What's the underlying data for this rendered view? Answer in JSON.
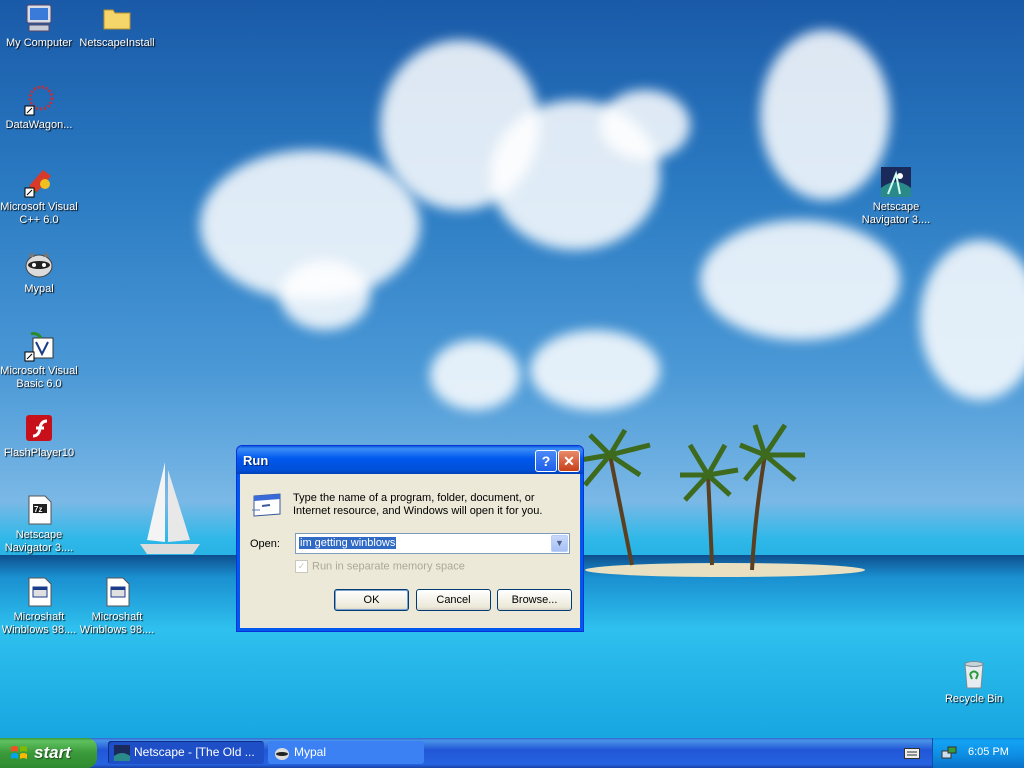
{
  "desktop": {
    "icons": [
      {
        "label": "My Computer",
        "icon": "my-computer-icon"
      },
      {
        "label": "NetscapeInstall",
        "icon": "folder-icon"
      },
      {
        "label": "DataWagon...",
        "icon": "datawagon-icon"
      },
      {
        "label": "Microsoft Visual C++ 6.0",
        "icon": "visual-cpp-icon"
      },
      {
        "label": "Mypal",
        "icon": "mypal-icon"
      },
      {
        "label": "Microsoft Visual Basic 6.0",
        "icon": "visual-basic-icon"
      },
      {
        "label": "FlashPlayer10",
        "icon": "flash-icon"
      },
      {
        "label": "Netscape Navigator 3....",
        "icon": "7z-icon"
      },
      {
        "label": "Microshaft Winblows 98....",
        "icon": "setup-icon"
      },
      {
        "label": "Microshaft Winblows 98....",
        "icon": "setup-icon"
      },
      {
        "label": "Netscape Navigator 3....",
        "icon": "netscape-icon"
      },
      {
        "label": "Recycle Bin",
        "icon": "recycle-bin-icon"
      }
    ]
  },
  "run_dialog": {
    "title": "Run",
    "help_label": "?",
    "close_label": "✕",
    "description": "Type the name of a program, folder, document, or Internet resource, and Windows will open it for you.",
    "open_label": "Open:",
    "open_value": "im getting winblows",
    "checkbox_label": "Run in separate memory space",
    "checkbox_checked": true,
    "checkbox_enabled": false,
    "ok_label": "OK",
    "cancel_label": "Cancel",
    "browse_label": "Browse..."
  },
  "taskbar": {
    "start_label": "start",
    "tasks": [
      {
        "label": "Netscape - [The Old ...",
        "active": true
      },
      {
        "label": "Mypal",
        "active": false
      }
    ],
    "clock": "6:05 PM"
  },
  "colors": {
    "titlebar": "#0058ee",
    "start": "#3c9a3c",
    "taskbar": "#2157d7",
    "selection": "#316ac5"
  }
}
